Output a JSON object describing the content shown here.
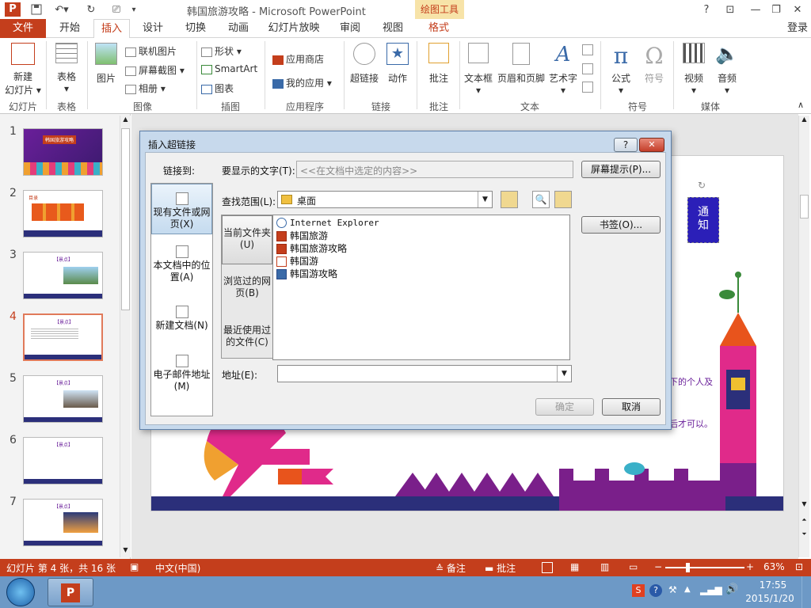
{
  "window": {
    "title": "韩国旅游攻略 - Microsoft PowerPoint",
    "context_tab": "绘图工具",
    "app_icon_letter": "P",
    "help": "?",
    "login": "登录"
  },
  "tabs": [
    "文件",
    "开始",
    "插入",
    "设计",
    "切换",
    "动画",
    "幻灯片放映",
    "审阅",
    "视图",
    "格式"
  ],
  "active_tab": "插入",
  "ribbon": {
    "groups": {
      "slides": "幻灯片",
      "tables": "表格",
      "images": "图像",
      "illustrations": "插图",
      "apps": "应用程序",
      "links": "链接",
      "comments": "批注",
      "text": "文本",
      "symbols": "符号",
      "media": "媒体"
    },
    "new_slide": "新建",
    "new_slide_2": "幻灯片",
    "table": "表格",
    "picture": "图片",
    "online_picture": "联机图片",
    "screenshot": "屏幕截图",
    "album": "相册",
    "shapes": "形状",
    "smartart": "SmartArt",
    "chart": "图表",
    "app_store": "应用商店",
    "my_apps": "我的应用",
    "hyperlink": "超链接",
    "action": "动作",
    "comment": "批注",
    "textbox": "文本框",
    "header_footer": "页眉和页脚",
    "wordart": "艺术字",
    "equation": "公式",
    "symbol": "符号",
    "video": "视频",
    "audio": "音频"
  },
  "thumbnails": [
    "1",
    "2",
    "3",
    "4",
    "5",
    "6",
    "7"
  ],
  "selected_thumbnail": "4",
  "thumb_titles": [
    "韩国旅游攻略",
    "目录",
    "【景点】",
    "【景点】",
    "【景点】",
    "【景点】",
    "【景点】"
  ],
  "slide": {
    "notice_text_1": "通",
    "notice_text_2": "知",
    "text_right_1": "下的个人及",
    "text_right_2": "后才可以。"
  },
  "dialog": {
    "title": "插入超链接",
    "help": "?",
    "close": "✕",
    "link_to_label": "链接到:",
    "link_to": [
      {
        "label": "现有文件或网页(X)",
        "icon": "globe-file-icon"
      },
      {
        "label": "本文档中的位置(A)",
        "icon": "document-place-icon"
      },
      {
        "label": "新建文档(N)",
        "icon": "new-document-icon"
      },
      {
        "label": "电子邮件地址(M)",
        "icon": "email-icon"
      }
    ],
    "display_text_label": "要显示的文字(T):",
    "display_text_value": "<<在文档中选定的内容>>",
    "screen_tip": "屏幕提示(P)...",
    "look_in_label": "查找范围(L):",
    "look_in_value": "桌面",
    "nav": [
      {
        "label": "当前文件夹(U)"
      },
      {
        "label": "浏览过的网页(B)"
      },
      {
        "label": "最近使用过的文件(C)"
      }
    ],
    "files": [
      {
        "name": "Internet Explorer",
        "icon": "ie-icon"
      },
      {
        "name": "韩国旅游",
        "icon": "ppt-file-icon"
      },
      {
        "name": "韩国旅游攻略",
        "icon": "ppt-file-icon"
      },
      {
        "name": "韩国游",
        "icon": "ppt-file-icon"
      },
      {
        "name": "韩国游攻略",
        "icon": "word-file-icon"
      }
    ],
    "bookmark": "书签(O)...",
    "address_label": "地址(E):",
    "address_value": "",
    "ok": "确定",
    "cancel": "取消"
  },
  "status": {
    "slide_info": "幻灯片 第 4 张，共 16 张",
    "language": "中文(中国)",
    "notes": "备注",
    "comments": "批注",
    "zoom": "63%"
  },
  "taskbar": {
    "time": "17:55",
    "date": "2015/1/20"
  },
  "colors": {
    "accent": "#c43e1c",
    "context_tab": "#f7e3a8",
    "taskbar": "#6d99c6",
    "dialog_frame": "#c7d9ec"
  }
}
